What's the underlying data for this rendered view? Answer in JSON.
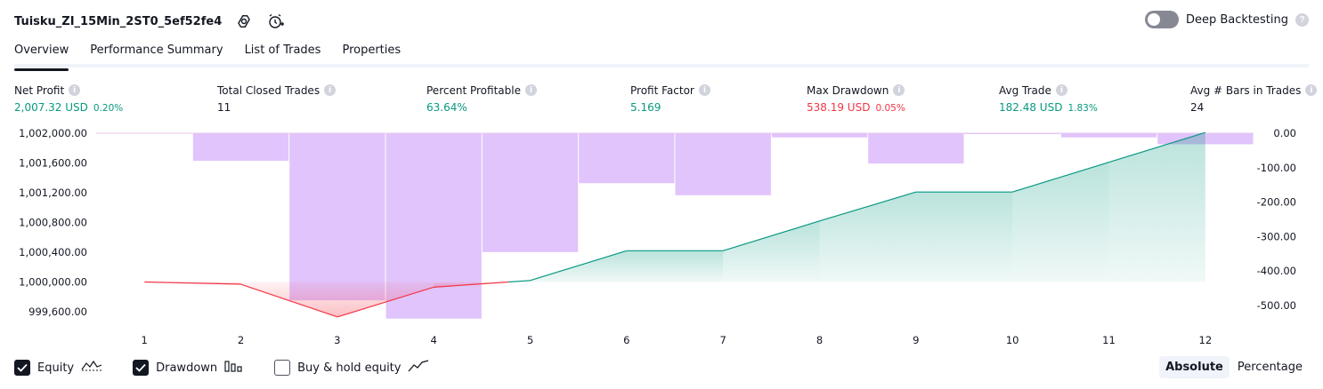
{
  "header": {
    "strategy_name": "Tuisku_ZI_15Min_2ST0_5ef52fe4",
    "icons": [
      "settings-icon",
      "add-alert-icon"
    ]
  },
  "deep_backtesting": {
    "label": "Deep Backtesting",
    "enabled": false,
    "help": "?"
  },
  "tabs": [
    {
      "label": "Overview",
      "active": true
    },
    {
      "label": "Performance Summary",
      "active": false
    },
    {
      "label": "List of Trades",
      "active": false
    },
    {
      "label": "Properties",
      "active": false
    }
  ],
  "metrics": [
    {
      "label": "Net Profit",
      "value": "2,007.32 USD",
      "pct": "0.20%",
      "color": "#089981"
    },
    {
      "label": "Total Closed Trades",
      "value": "11",
      "pct": "",
      "color": "#131722"
    },
    {
      "label": "Percent Profitable",
      "value": "63.64%",
      "pct": "",
      "color": "#089981"
    },
    {
      "label": "Profit Factor",
      "value": "5.169",
      "pct": "",
      "color": "#089981"
    },
    {
      "label": "Max Drawdown",
      "value": "538.19 USD",
      "pct": "0.05%",
      "color": "#f23645"
    },
    {
      "label": "Avg Trade",
      "value": "182.48 USD",
      "pct": "1.83%",
      "color": "#089981"
    },
    {
      "label": "Avg # Bars in Trades",
      "value": "24",
      "pct": "",
      "color": "#131722"
    }
  ],
  "chart_data": {
    "type": "line",
    "x": [
      1,
      2,
      3,
      4,
      5,
      6,
      7,
      8,
      9,
      10,
      11,
      12
    ],
    "left_axis": {
      "ticks": [
        "1,002,000.00",
        "1,001,600.00",
        "1,001,200.00",
        "1,000,800.00",
        "1,000,400.00",
        "1,000,000.00",
        "999,600.00"
      ],
      "range": [
        999600,
        1002000
      ]
    },
    "right_axis": {
      "ticks": [
        "0.00",
        "-100.00",
        "-200.00",
        "-300.00",
        "-400.00",
        "-500.00"
      ],
      "range": [
        -500,
        0
      ]
    },
    "series": [
      {
        "name": "Equity",
        "axis": "left",
        "values": [
          1000000,
          999970,
          999530,
          999930,
          1000020,
          1000420,
          1000420,
          1000820,
          1001210,
          1001210,
          1001610,
          1002010
        ],
        "color_up": "#089981",
        "color_down": "#f23645"
      },
      {
        "name": "Drawdown",
        "axis": "right",
        "type": "bar",
        "values": [
          0,
          -80,
          -485,
          -538,
          -345,
          -145,
          -180,
          -12,
          -88,
          -2,
          -12,
          -32
        ],
        "color": "#e1c4fb"
      }
    ]
  },
  "legend": [
    {
      "label": "Equity",
      "checked": true,
      "icon": "equity-line-icon"
    },
    {
      "label": "Drawdown",
      "checked": true,
      "icon": "drawdown-bars-icon"
    },
    {
      "label": "Buy & hold equity",
      "checked": false,
      "icon": "buy-hold-line-icon"
    }
  ],
  "mode": [
    {
      "label": "Absolute",
      "active": true
    },
    {
      "label": "Percentage",
      "active": false
    }
  ]
}
